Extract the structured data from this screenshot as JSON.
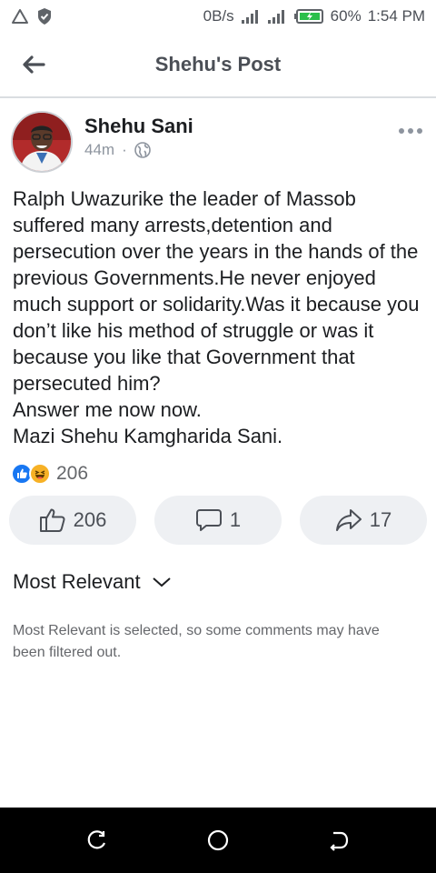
{
  "status_bar": {
    "speed": "0B/s",
    "battery": "60%",
    "time": "1:54 PM"
  },
  "header": {
    "title": "Shehu's Post"
  },
  "post": {
    "author": "Shehu Sani",
    "time_ago": "44m",
    "separator": "·",
    "audience_icon": "globe-icon",
    "text": "Ralph Uwazurike the leader of Massob suffered many arrests,detention and persecution over the years in the hands of the previous Governments.He never enjoyed much support or solidarity.Was it because you don’t like his method of struggle or was it because you like that Government that persecuted him?\nAnswer me now now.\nMazi Shehu Kamgharida Sani.",
    "reactions_count": "206"
  },
  "actions": {
    "like_count": "206",
    "comment_count": "1",
    "share_count": "17"
  },
  "comments": {
    "sort_label": "Most Relevant",
    "sort_note": "Most Relevant is selected, so some comments may have been filtered out."
  },
  "colors": {
    "like_blue": "#1877f2",
    "haha_yellow": "#f7b125",
    "button_bg": "#eef0f3"
  }
}
